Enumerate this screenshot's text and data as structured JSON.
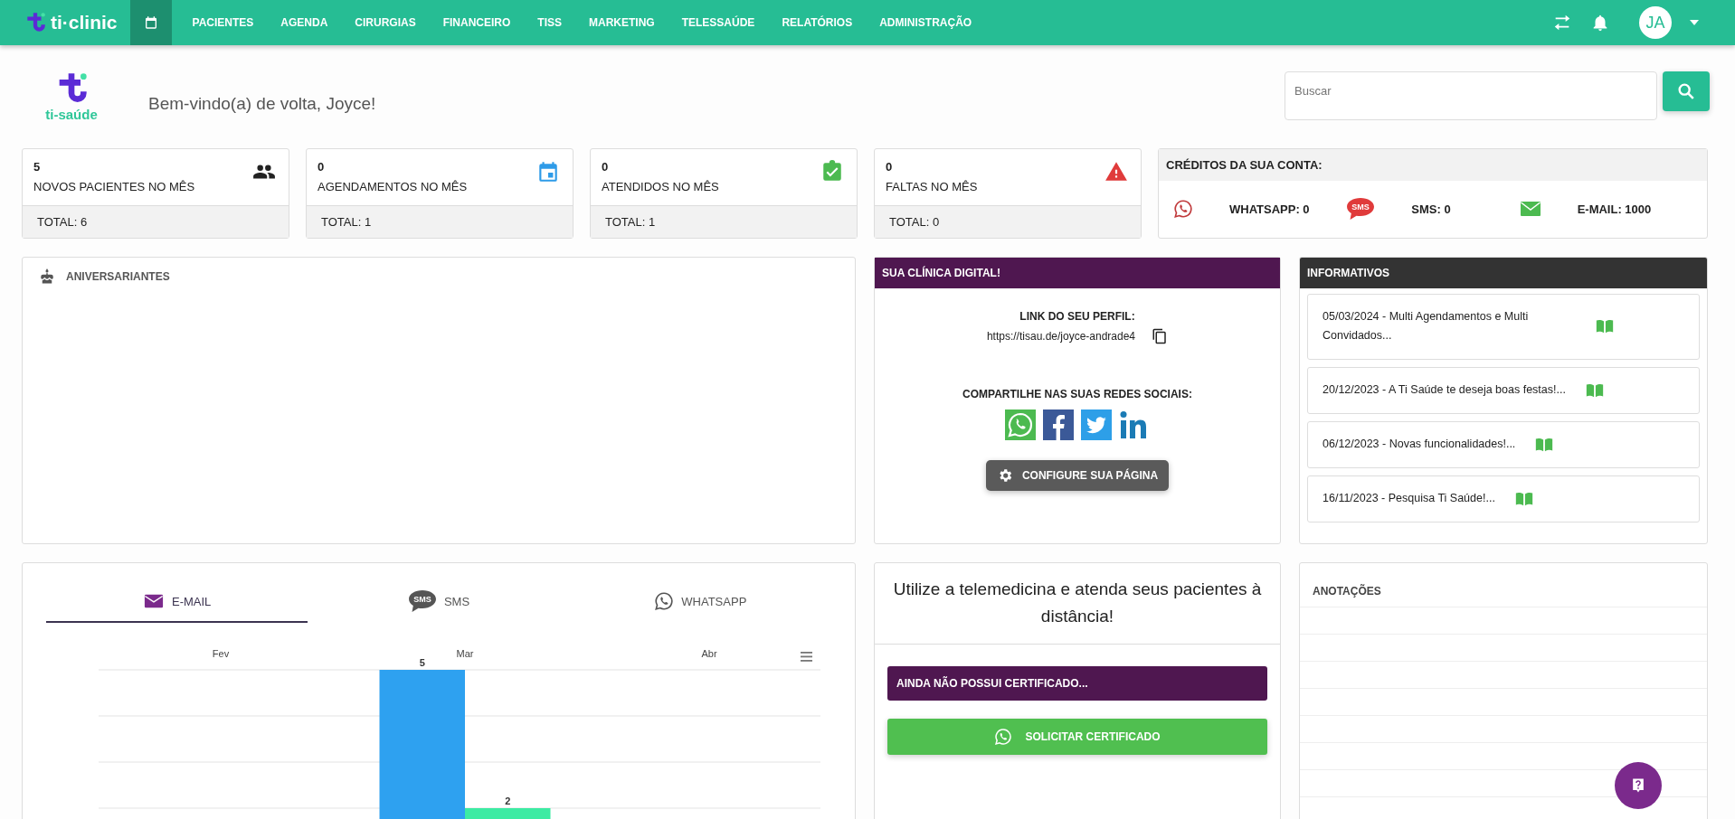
{
  "navbar": {
    "brand": "ti·clinic",
    "items": [
      {
        "kind": "icon",
        "selected": true
      },
      {
        "kind": "text",
        "label": "PACIENTES",
        "selected": false
      },
      {
        "kind": "text",
        "label": "AGENDA",
        "selected": false
      },
      {
        "kind": "text",
        "label": "CIRURGIAS",
        "selected": false
      },
      {
        "kind": "text",
        "label": "FINANCEIRO",
        "selected": false
      },
      {
        "kind": "text",
        "label": "TISS",
        "selected": false
      },
      {
        "kind": "text",
        "label": "MARKETING",
        "selected": false
      },
      {
        "kind": "text",
        "label": "TELESSAÚDE",
        "selected": false
      },
      {
        "kind": "text",
        "label": "RELATÓRIOS",
        "selected": false
      },
      {
        "kind": "text",
        "label": "ADMINISTRAÇÃO",
        "selected": false
      }
    ],
    "avatar": "JA"
  },
  "header": {
    "logo_text": "ti-saúde",
    "welcome": "Bem-vindo(a) de volta, Joyce!",
    "search": {
      "placeholder": "Buscar"
    }
  },
  "stats": [
    {
      "kind": "people",
      "value": "5",
      "label": "NOVOS PACIENTES NO MÊS",
      "total": "TOTAL: 6"
    },
    {
      "kind": "calendar",
      "value": "0",
      "label": "AGENDAMENTOS NO MÊS",
      "total": "TOTAL: 1"
    },
    {
      "kind": "check",
      "value": "0",
      "label": "ATENDIDOS NO MÊS",
      "total": "TOTAL: 1"
    },
    {
      "kind": "warning",
      "value": "0",
      "label": "FALTAS NO MÊS",
      "total": "TOTAL: 0"
    }
  ],
  "credits": {
    "title": "CRÉDITOS DA SUA CONTA:",
    "items": [
      {
        "kind": "whatsapp",
        "label": "WHATSAPP: 0"
      },
      {
        "kind": "sms",
        "label": "SMS: 0",
        "icon_text": "SMS"
      },
      {
        "kind": "email",
        "label": "E-MAIL: 1000"
      }
    ]
  },
  "birthdays": {
    "title": "ANIVERSARIANTES"
  },
  "clinic": {
    "title": "SUA CLÍNICA DIGITAL!",
    "link_label": "LINK DO SEU PERFIL:",
    "link": "https://tisau.de/joyce-andrade4",
    "share_label": "COMPARTILHE NAS SUAS REDES SOCIAIS:",
    "socials": [
      {
        "kind": "whatsapp"
      },
      {
        "kind": "facebook"
      },
      {
        "kind": "twitter"
      },
      {
        "kind": "linkedin"
      }
    ],
    "button": "CONFIGURE SUA PÁGINA"
  },
  "news": {
    "title": "INFORMATIVOS",
    "items": [
      {
        "text": "05/03/2024 - Multi Agendamentos e Multi Convidados..."
      },
      {
        "text": "20/12/2023 - A Ti Saúde te deseja boas festas!..."
      },
      {
        "text": "06/12/2023 - Novas funcionalidades!..."
      },
      {
        "text": "16/11/2023 - Pesquisa Ti Saúde!..."
      }
    ]
  },
  "messages": {
    "tabs": [
      {
        "kind": "email",
        "label": "E-MAIL",
        "selected": true
      },
      {
        "kind": "sms",
        "label": "SMS",
        "icon_text": "SMS",
        "selected": false
      },
      {
        "kind": "whatsapp",
        "label": "WHATSAPP",
        "selected": false
      }
    ],
    "chart_data": {
      "type": "bar",
      "categories": [
        "Fev",
        "Mar",
        "Abr"
      ],
      "series": [
        {
          "color": "#2ea1f0",
          "values": [
            null,
            5,
            null
          ]
        },
        {
          "color": "#3deba3",
          "values": [
            null,
            2,
            null
          ]
        }
      ],
      "data_labels": true
    }
  },
  "telemedicine": {
    "text": "Utilize a telemedicina e atenda seus pacientes à distância!",
    "notice": "AINDA NÃO POSSUI CERTIFICADO...",
    "button": "SOLICITAR CERTIFICADO"
  },
  "notes": {
    "title": "ANOTAÇÕES"
  }
}
